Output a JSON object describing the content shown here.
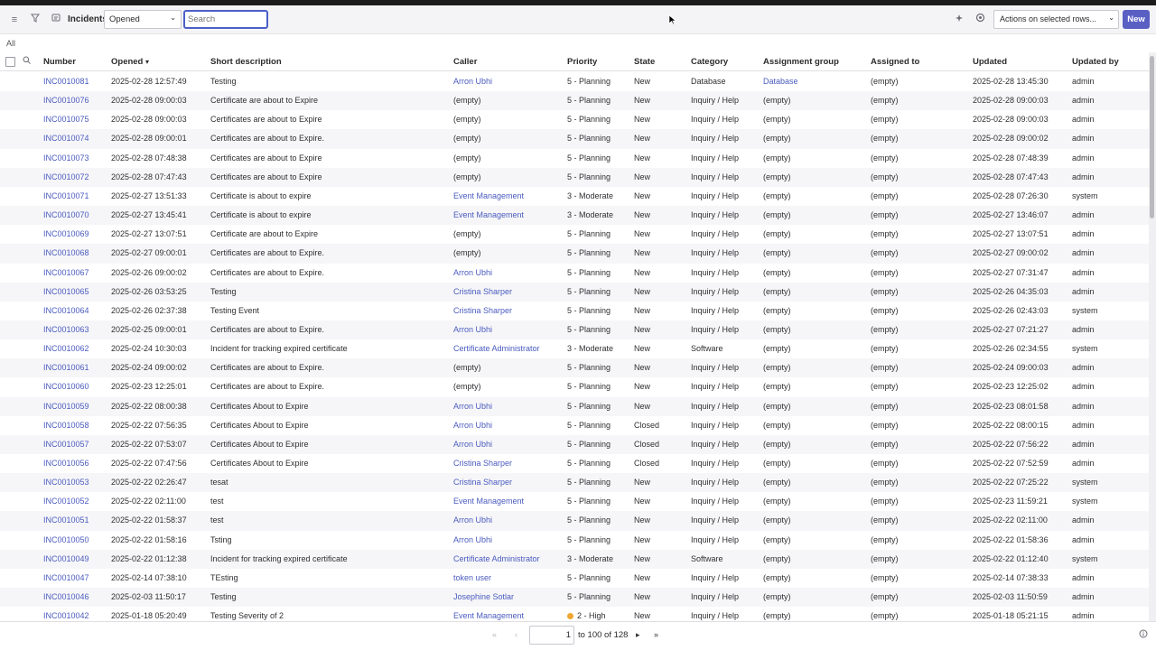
{
  "toolbar": {
    "title": "Incidents",
    "filter_field": "Opened",
    "search_placeholder": "Search",
    "actions_select": "Actions on selected rows...",
    "new_label": "New",
    "icons": [
      "menu-icon",
      "filter-icon",
      "list-icon",
      "pin-icon",
      "gear-icon"
    ]
  },
  "breadcrumb": "All",
  "columns": {
    "number": "Number",
    "opened": "Opened",
    "short_description": "Short description",
    "caller": "Caller",
    "priority": "Priority",
    "state": "State",
    "category": "Category",
    "assignment_group": "Assignment group",
    "assigned_to": "Assigned to",
    "updated": "Updated",
    "updated_by": "Updated by",
    "sort_indicator": "▾"
  },
  "rows": [
    {
      "number": "INC0010081",
      "opened": "2025-02-28 12:57:49",
      "desc": "Testing",
      "caller": "Arron Ubhi",
      "caller_link": true,
      "priority": "5 - Planning",
      "state": "New",
      "category": "Database",
      "group": "Database",
      "group_link": true,
      "assigned": "(empty)",
      "updated": "2025-02-28 13:45:30",
      "updated_by": "admin"
    },
    {
      "number": "INC0010076",
      "opened": "2025-02-28 09:00:03",
      "desc": "Certificate are about to Expire",
      "caller": "(empty)",
      "caller_link": false,
      "priority": "5 - Planning",
      "state": "New",
      "category": "Inquiry / Help",
      "group": "(empty)",
      "group_link": false,
      "assigned": "(empty)",
      "updated": "2025-02-28 09:00:03",
      "updated_by": "admin"
    },
    {
      "number": "INC0010075",
      "opened": "2025-02-28 09:00:03",
      "desc": "Certificates are about to Expire",
      "caller": "(empty)",
      "caller_link": false,
      "priority": "5 - Planning",
      "state": "New",
      "category": "Inquiry / Help",
      "group": "(empty)",
      "group_link": false,
      "assigned": "(empty)",
      "updated": "2025-02-28 09:00:03",
      "updated_by": "admin"
    },
    {
      "number": "INC0010074",
      "opened": "2025-02-28 09:00:01",
      "desc": "Certificates are about to Expire.",
      "caller": "(empty)",
      "caller_link": false,
      "priority": "5 - Planning",
      "state": "New",
      "category": "Inquiry / Help",
      "group": "(empty)",
      "group_link": false,
      "assigned": "(empty)",
      "updated": "2025-02-28 09:00:02",
      "updated_by": "admin"
    },
    {
      "number": "INC0010073",
      "opened": "2025-02-28 07:48:38",
      "desc": "Certificates are about to Expire",
      "caller": "(empty)",
      "caller_link": false,
      "priority": "5 - Planning",
      "state": "New",
      "category": "Inquiry / Help",
      "group": "(empty)",
      "group_link": false,
      "assigned": "(empty)",
      "updated": "2025-02-28 07:48:39",
      "updated_by": "admin"
    },
    {
      "number": "INC0010072",
      "opened": "2025-02-28 07:47:43",
      "desc": "Certificates are about to Expire",
      "caller": "(empty)",
      "caller_link": false,
      "priority": "5 - Planning",
      "state": "New",
      "category": "Inquiry / Help",
      "group": "(empty)",
      "group_link": false,
      "assigned": "(empty)",
      "updated": "2025-02-28 07:47:43",
      "updated_by": "admin"
    },
    {
      "number": "INC0010071",
      "opened": "2025-02-27 13:51:33",
      "desc": "Certificate is about to expire",
      "caller": "Event Management",
      "caller_link": true,
      "priority": "3 - Moderate",
      "state": "New",
      "category": "Inquiry / Help",
      "group": "(empty)",
      "group_link": false,
      "assigned": "(empty)",
      "updated": "2025-02-28 07:26:30",
      "updated_by": "system"
    },
    {
      "number": "INC0010070",
      "opened": "2025-02-27 13:45:41",
      "desc": "Certificate is about to expire",
      "caller": "Event Management",
      "caller_link": true,
      "priority": "3 - Moderate",
      "state": "New",
      "category": "Inquiry / Help",
      "group": "(empty)",
      "group_link": false,
      "assigned": "(empty)",
      "updated": "2025-02-27 13:46:07",
      "updated_by": "admin"
    },
    {
      "number": "INC0010069",
      "opened": "2025-02-27 13:07:51",
      "desc": "Certificate are about to Expire",
      "caller": "(empty)",
      "caller_link": false,
      "priority": "5 - Planning",
      "state": "New",
      "category": "Inquiry / Help",
      "group": "(empty)",
      "group_link": false,
      "assigned": "(empty)",
      "updated": "2025-02-27 13:07:51",
      "updated_by": "admin"
    },
    {
      "number": "INC0010068",
      "opened": "2025-02-27 09:00:01",
      "desc": "Certificates are about to Expire.",
      "caller": "(empty)",
      "caller_link": false,
      "priority": "5 - Planning",
      "state": "New",
      "category": "Inquiry / Help",
      "group": "(empty)",
      "group_link": false,
      "assigned": "(empty)",
      "updated": "2025-02-27 09:00:02",
      "updated_by": "admin"
    },
    {
      "number": "INC0010067",
      "opened": "2025-02-26 09:00:02",
      "desc": "Certificates are about to Expire.",
      "caller": "Arron Ubhi",
      "caller_link": true,
      "priority": "5 - Planning",
      "state": "New",
      "category": "Inquiry / Help",
      "group": "(empty)",
      "group_link": false,
      "assigned": "(empty)",
      "updated": "2025-02-27 07:31:47",
      "updated_by": "admin"
    },
    {
      "number": "INC0010065",
      "opened": "2025-02-26 03:53:25",
      "desc": "Testing",
      "caller": "Cristina Sharper",
      "caller_link": true,
      "priority": "5 - Planning",
      "state": "New",
      "category": "Inquiry / Help",
      "group": "(empty)",
      "group_link": false,
      "assigned": "(empty)",
      "updated": "2025-02-26 04:35:03",
      "updated_by": "admin"
    },
    {
      "number": "INC0010064",
      "opened": "2025-02-26 02:37:38",
      "desc": "Testing Event",
      "caller": "Cristina Sharper",
      "caller_link": true,
      "priority": "5 - Planning",
      "state": "New",
      "category": "Inquiry / Help",
      "group": "(empty)",
      "group_link": false,
      "assigned": "(empty)",
      "updated": "2025-02-26 02:43:03",
      "updated_by": "system"
    },
    {
      "number": "INC0010063",
      "opened": "2025-02-25 09:00:01",
      "desc": "Certificates are about to Expire.",
      "caller": "Arron Ubhi",
      "caller_link": true,
      "priority": "5 - Planning",
      "state": "New",
      "category": "Inquiry / Help",
      "group": "(empty)",
      "group_link": false,
      "assigned": "(empty)",
      "updated": "2025-02-27 07:21:27",
      "updated_by": "admin"
    },
    {
      "number": "INC0010062",
      "opened": "2025-02-24 10:30:03",
      "desc": "Incident for tracking expired certificate",
      "caller": "Certificate Administrator",
      "caller_link": true,
      "priority": "3 - Moderate",
      "state": "New",
      "category": "Software",
      "group": "(empty)",
      "group_link": false,
      "assigned": "(empty)",
      "updated": "2025-02-26 02:34:55",
      "updated_by": "system"
    },
    {
      "number": "INC0010061",
      "opened": "2025-02-24 09:00:02",
      "desc": "Certificates are about to Expire.",
      "caller": "(empty)",
      "caller_link": false,
      "priority": "5 - Planning",
      "state": "New",
      "category": "Inquiry / Help",
      "group": "(empty)",
      "group_link": false,
      "assigned": "(empty)",
      "updated": "2025-02-24 09:00:03",
      "updated_by": "admin"
    },
    {
      "number": "INC0010060",
      "opened": "2025-02-23 12:25:01",
      "desc": "Certificates are about to Expire.",
      "caller": "(empty)",
      "caller_link": false,
      "priority": "5 - Planning",
      "state": "New",
      "category": "Inquiry / Help",
      "group": "(empty)",
      "group_link": false,
      "assigned": "(empty)",
      "updated": "2025-02-23 12:25:02",
      "updated_by": "admin"
    },
    {
      "number": "INC0010059",
      "opened": "2025-02-22 08:00:38",
      "desc": "Certificates About to Expire",
      "caller": "Arron Ubhi",
      "caller_link": true,
      "priority": "5 - Planning",
      "state": "New",
      "category": "Inquiry / Help",
      "group": "(empty)",
      "group_link": false,
      "assigned": "(empty)",
      "updated": "2025-02-23 08:01:58",
      "updated_by": "admin"
    },
    {
      "number": "INC0010058",
      "opened": "2025-02-22 07:56:35",
      "desc": "Certificates About to Expire",
      "caller": "Arron Ubhi",
      "caller_link": true,
      "priority": "5 - Planning",
      "state": "Closed",
      "category": "Inquiry / Help",
      "group": "(empty)",
      "group_link": false,
      "assigned": "(empty)",
      "updated": "2025-02-22 08:00:15",
      "updated_by": "admin"
    },
    {
      "number": "INC0010057",
      "opened": "2025-02-22 07:53:07",
      "desc": "Certificates About to Expire",
      "caller": "Arron Ubhi",
      "caller_link": true,
      "priority": "5 - Planning",
      "state": "Closed",
      "category": "Inquiry / Help",
      "group": "(empty)",
      "group_link": false,
      "assigned": "(empty)",
      "updated": "2025-02-22 07:56:22",
      "updated_by": "admin"
    },
    {
      "number": "INC0010056",
      "opened": "2025-02-22 07:47:56",
      "desc": "Certificates About to Expire",
      "caller": "Cristina Sharper",
      "caller_link": true,
      "priority": "5 - Planning",
      "state": "Closed",
      "category": "Inquiry / Help",
      "group": "(empty)",
      "group_link": false,
      "assigned": "(empty)",
      "updated": "2025-02-22 07:52:59",
      "updated_by": "admin"
    },
    {
      "number": "INC0010053",
      "opened": "2025-02-22 02:26:47",
      "desc": "tesat",
      "caller": "Cristina Sharper",
      "caller_link": true,
      "priority": "5 - Planning",
      "state": "New",
      "category": "Inquiry / Help",
      "group": "(empty)",
      "group_link": false,
      "assigned": "(empty)",
      "updated": "2025-02-22 07:25:22",
      "updated_by": "system"
    },
    {
      "number": "INC0010052",
      "opened": "2025-02-22 02:11:00",
      "desc": "test",
      "caller": "Event Management",
      "caller_link": true,
      "priority": "5 - Planning",
      "state": "New",
      "category": "Inquiry / Help",
      "group": "(empty)",
      "group_link": false,
      "assigned": "(empty)",
      "updated": "2025-02-23 11:59:21",
      "updated_by": "system"
    },
    {
      "number": "INC0010051",
      "opened": "2025-02-22 01:58:37",
      "desc": "test",
      "caller": "Arron Ubhi",
      "caller_link": true,
      "priority": "5 - Planning",
      "state": "New",
      "category": "Inquiry / Help",
      "group": "(empty)",
      "group_link": false,
      "assigned": "(empty)",
      "updated": "2025-02-22 02:11:00",
      "updated_by": "admin"
    },
    {
      "number": "INC0010050",
      "opened": "2025-02-22 01:58:16",
      "desc": "Tsting",
      "caller": "Arron Ubhi",
      "caller_link": true,
      "priority": "5 - Planning",
      "state": "New",
      "category": "Inquiry / Help",
      "group": "(empty)",
      "group_link": false,
      "assigned": "(empty)",
      "updated": "2025-02-22 01:58:36",
      "updated_by": "admin"
    },
    {
      "number": "INC0010049",
      "opened": "2025-02-22 01:12:38",
      "desc": "Incident for tracking expired certificate",
      "caller": "Certificate Administrator",
      "caller_link": true,
      "priority": "3 - Moderate",
      "state": "New",
      "category": "Software",
      "group": "(empty)",
      "group_link": false,
      "assigned": "(empty)",
      "updated": "2025-02-22 01:12:40",
      "updated_by": "system"
    },
    {
      "number": "INC0010047",
      "opened": "2025-02-14 07:38:10",
      "desc": "TEsting",
      "caller": "token user",
      "caller_link": true,
      "priority": "5 - Planning",
      "state": "New",
      "category": "Inquiry / Help",
      "group": "(empty)",
      "group_link": false,
      "assigned": "(empty)",
      "updated": "2025-02-14 07:38:33",
      "updated_by": "admin"
    },
    {
      "number": "INC0010046",
      "opened": "2025-02-03 11:50:17",
      "desc": "Testing",
      "caller": "Josephine Sotlar",
      "caller_link": true,
      "priority": "5 - Planning",
      "state": "New",
      "category": "Inquiry / Help",
      "group": "(empty)",
      "group_link": false,
      "assigned": "(empty)",
      "updated": "2025-02-03 11:50:59",
      "updated_by": "admin"
    },
    {
      "number": "INC0010042",
      "opened": "2025-01-18 05:20:49",
      "desc": "Testing Severity of 2",
      "caller": "Event Management",
      "caller_link": true,
      "priority": "2 - High",
      "priority_dot": true,
      "state": "New",
      "category": "Inquiry / Help",
      "group": "(empty)",
      "group_link": false,
      "assigned": "(empty)",
      "updated": "2025-01-18 05:21:15",
      "updated_by": "admin"
    }
  ],
  "pagination": {
    "current_page": "1",
    "range_text": "to 100 of 128"
  },
  "colors": {
    "accent": "#5a5fc4",
    "link": "#4a5bbf",
    "high_priority_dot": "#f0a62f"
  }
}
